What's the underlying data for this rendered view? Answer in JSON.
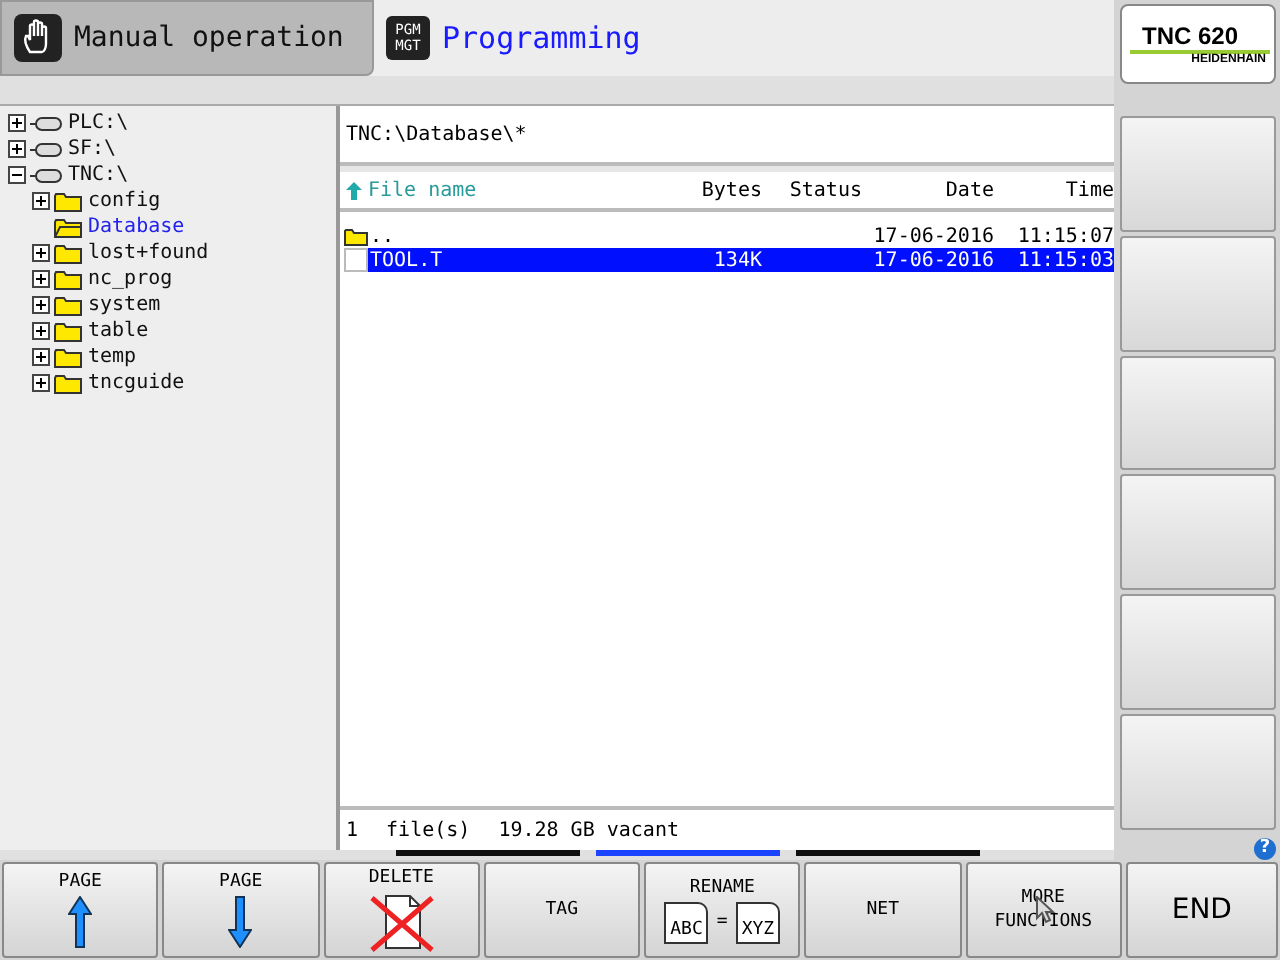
{
  "modes": [
    {
      "kind": "machine",
      "label": "Manual operation"
    },
    {
      "kind": "programming",
      "label": "Programming",
      "badge_lines": [
        "PGM",
        "MGT"
      ]
    }
  ],
  "logo": {
    "model": "TNC 620",
    "brand": "HEIDENHAIN"
  },
  "tree": [
    {
      "label": "PLC:\\",
      "kind": "drive",
      "expanded": false,
      "selected": false
    },
    {
      "label": "SF:\\",
      "kind": "drive",
      "expanded": false,
      "selected": false
    },
    {
      "label": "TNC:\\",
      "kind": "drive",
      "expanded": true,
      "selected": false,
      "children": [
        {
          "label": "config",
          "kind": "folder",
          "expanded": false,
          "selected": false
        },
        {
          "label": "Database",
          "kind": "folder",
          "selected": true
        },
        {
          "label": "lost+found",
          "kind": "folder",
          "expanded": false,
          "selected": false
        },
        {
          "label": "nc_prog",
          "kind": "folder",
          "expanded": false,
          "selected": false
        },
        {
          "label": "system",
          "kind": "folder",
          "expanded": false,
          "selected": false
        },
        {
          "label": "table",
          "kind": "folder",
          "expanded": false,
          "selected": false
        },
        {
          "label": "temp",
          "kind": "folder",
          "expanded": false,
          "selected": false
        },
        {
          "label": "tncguide",
          "kind": "folder",
          "expanded": false,
          "selected": false
        }
      ]
    }
  ],
  "path": "TNC:\\Database\\*",
  "columns": [
    "File name",
    "Bytes",
    "Status",
    "Date",
    "Time"
  ],
  "files": [
    {
      "kind": "folder",
      "name": "..",
      "date": "17-06-2016",
      "time": "11:15:07",
      "selected": false
    },
    {
      "kind": "file",
      "name": "TOOL.T",
      "bytes": "134K",
      "date": "17-06-2016",
      "time": "11:15:03",
      "selected": true
    }
  ],
  "status": {
    "count": "1",
    "unit": "file(s)",
    "free": "19.28 GB vacant"
  },
  "softkey_rows": [
    {
      "selected": false
    },
    {
      "selected": true
    },
    {
      "selected": false
    }
  ],
  "help_label": "?",
  "softkeys": [
    {
      "kind": "up",
      "label": "PAGE"
    },
    {
      "kind": "down",
      "label": "PAGE"
    },
    {
      "kind": "delete",
      "label": "DELETE"
    },
    {
      "kind": "text",
      "label": "TAG"
    },
    {
      "kind": "rename",
      "label": "RENAME",
      "from": "ABC",
      "eq": "=",
      "to": "XYZ"
    },
    {
      "kind": "text",
      "label": "NET"
    },
    {
      "kind": "cursor",
      "label": "MORE",
      "label2": "FUNCTIONS"
    },
    {
      "kind": "big",
      "label": "END"
    }
  ]
}
